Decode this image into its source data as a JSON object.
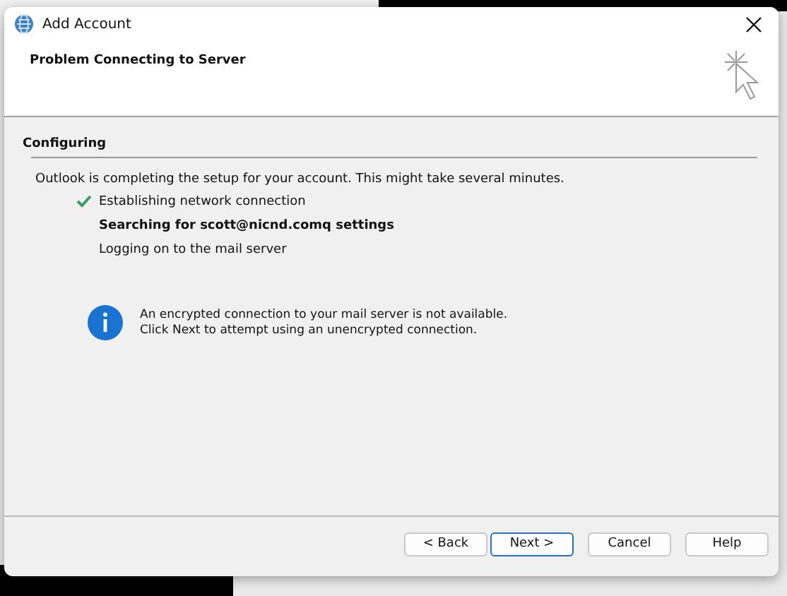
{
  "window": {
    "title": "Add Account"
  },
  "header": {
    "title": "Problem Connecting to Server"
  },
  "section": {
    "title": "Configuring"
  },
  "intro": "Outlook is completing the setup for your account. This might take several minutes.",
  "steps": [
    {
      "label": "Establishing network connection",
      "done": true,
      "current": false
    },
    {
      "label": "Searching for scott@nicnd.comq settings",
      "done": false,
      "current": true
    },
    {
      "label": "Logging on to the mail server",
      "done": false,
      "current": false
    }
  ],
  "notice": {
    "lines": [
      "An encrypted connection to your mail server is not available.",
      "Click Next to attempt using an unencrypted connection."
    ]
  },
  "buttons": [
    {
      "label": "< Back",
      "default": false
    },
    {
      "label": "Next >",
      "default": true
    },
    {
      "label": "Cancel",
      "default": false
    },
    {
      "label": "Help",
      "default": false
    }
  ]
}
